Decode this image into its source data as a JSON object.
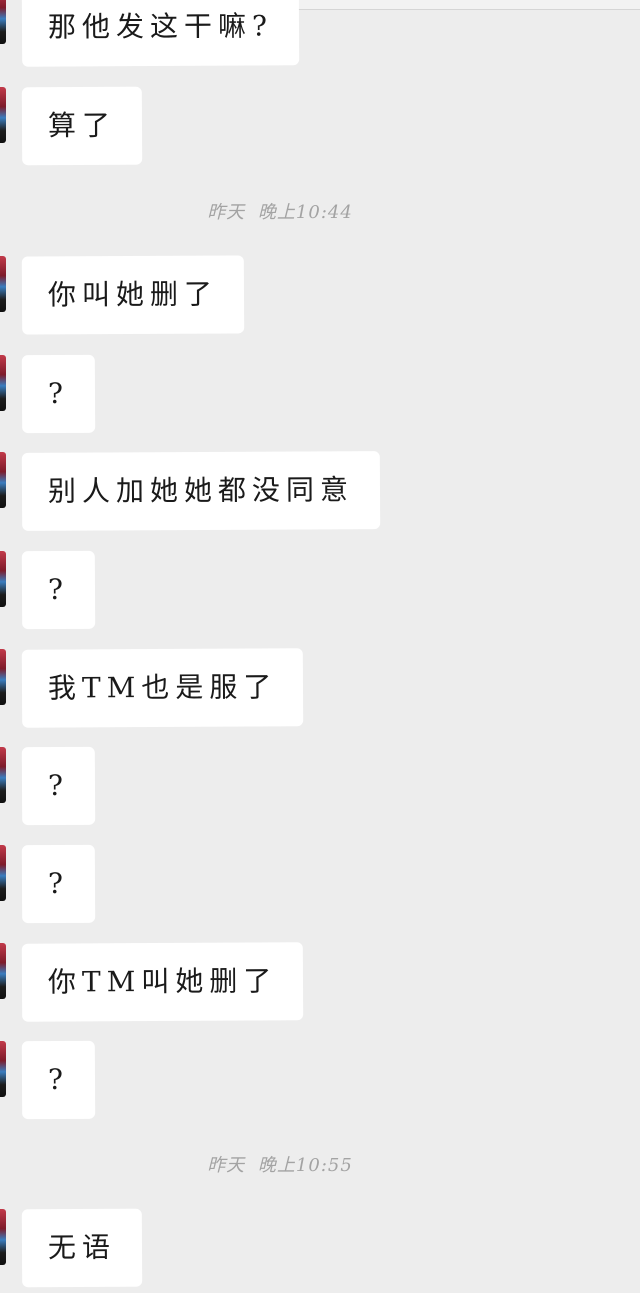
{
  "messages": [
    {
      "text": "那他发这干嘛?"
    },
    {
      "text": "算了"
    },
    {
      "text": "你叫她删了"
    },
    {
      "text": "?"
    },
    {
      "text": "别人加她她都没同意"
    },
    {
      "text": "?"
    },
    {
      "text": "我TM也是服了"
    },
    {
      "text": "?"
    },
    {
      "text": "?"
    },
    {
      "text": "你TM叫她删了"
    },
    {
      "text": "?"
    },
    {
      "text": "无语"
    }
  ],
  "timestamps": [
    {
      "text": "昨天 晚上10:44"
    },
    {
      "text": "昨天 晚上10:55"
    }
  ],
  "colors": {
    "background": "#ededed",
    "bubble": "#ffffff",
    "text": "#1a1a1a",
    "timestamp": "#a3a3a3"
  }
}
